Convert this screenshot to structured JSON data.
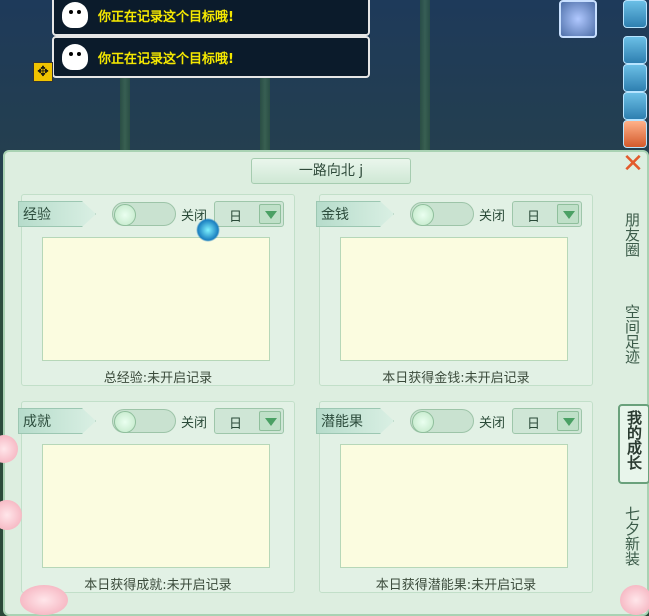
{
  "notifications": [
    {
      "message": "你正在记录这个目标哦!"
    },
    {
      "message": "你正在记录这个目标哦!"
    }
  ],
  "panel": {
    "title": "一路向北 j",
    "close": "✕"
  },
  "cards": [
    {
      "tag": "经验",
      "toggle_label": "关闭",
      "select_value": "日",
      "footer": "总经验:未开启记录"
    },
    {
      "tag": "金钱",
      "toggle_label": "关闭",
      "select_value": "日",
      "footer": "本日获得金钱:未开启记录"
    },
    {
      "tag": "成就",
      "toggle_label": "关闭",
      "select_value": "日",
      "footer": "本日获得成就:未开启记录"
    },
    {
      "tag": "潜能果",
      "toggle_label": "关闭",
      "select_value": "日",
      "footer": "本日获得潜能果:未开启记录"
    }
  ],
  "side_tabs": [
    {
      "label": "朋友圈"
    },
    {
      "label": "空间足迹"
    },
    {
      "label": "我的成长",
      "active": true
    },
    {
      "label": "七夕新装"
    }
  ]
}
